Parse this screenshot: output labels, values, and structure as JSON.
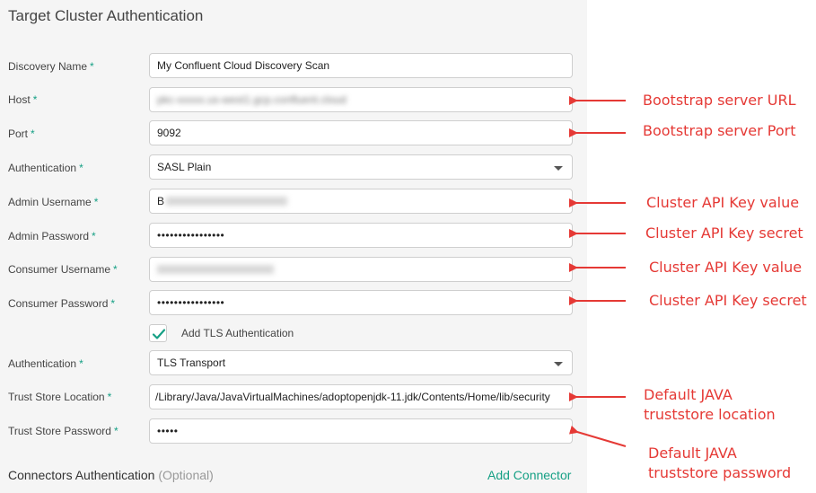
{
  "title": "Target Cluster Authentication",
  "fields": [
    {
      "label": "Discovery Name",
      "value": "My Confluent Cloud Discovery Scan"
    },
    {
      "label": "Host",
      "value": "pkc-xxxxx.us-west1.gcp.confluent.cloud"
    },
    {
      "label": "Port",
      "value": "9092"
    },
    {
      "label": "Authentication",
      "value": "SASL Plain"
    },
    {
      "label": "Admin Username",
      "value": "B"
    },
    {
      "label": "Admin Password",
      "value": "••••••••••••••••"
    },
    {
      "label": "Consumer Username",
      "value": ""
    },
    {
      "label": "Consumer Password",
      "value": "••••••••••••••••"
    },
    {
      "label": "Authentication",
      "value": "TLS Transport"
    },
    {
      "label": "Trust Store Location",
      "value": "/Library/Java/JavaVirtualMachines/adoptopenjdk-11.jdk/Contents/Home/lib/security"
    },
    {
      "label": "Trust Store Password",
      "value": "•••••"
    }
  ],
  "required_marker": "*",
  "tls_checkbox": {
    "label": "Add TLS Authentication",
    "checked": true
  },
  "connectors": {
    "title": "Connectors Authentication",
    "optional": "(Optional)",
    "add_label": "Add Connector"
  },
  "annotations": [
    "Bootstrap server URL",
    "Bootstrap server Port",
    "Cluster API Key value",
    "Cluster API Key secret",
    "Cluster API Key value",
    "Cluster API Key secret",
    "Default JAVA",
    "truststore location",
    "Default JAVA",
    "truststore password"
  ],
  "colors": {
    "accent": "#16a085",
    "annotation": "#e53935",
    "panel": "#f5f5f5"
  },
  "icons": {
    "dropdown": "chevron-down-icon",
    "checkbox": "checkmark-icon"
  }
}
